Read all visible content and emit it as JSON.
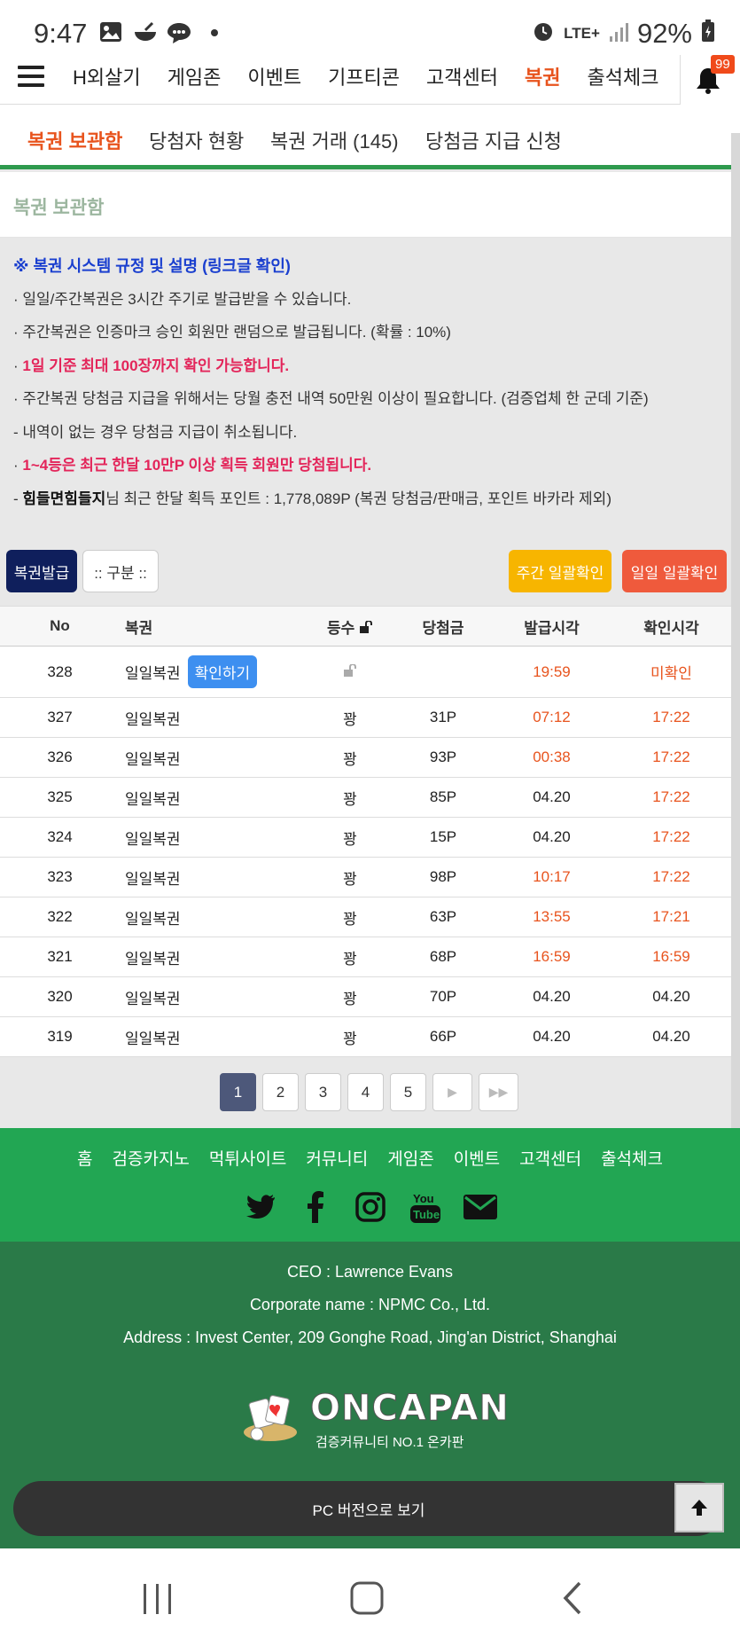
{
  "status_bar": {
    "time": "9:47",
    "network": "LTE+",
    "battery": "92%"
  },
  "top_nav": {
    "items": [
      "H외살기",
      "게임존",
      "이벤트",
      "기프티콘",
      "고객센터",
      "복권",
      "출석체크"
    ],
    "active_index": 5,
    "notification_count": "99"
  },
  "sub_tabs": [
    "복권 보관함",
    "당첨자 현황",
    "복권 거래 (145)",
    "당첨금 지급 신청"
  ],
  "section_title": "복권 보관함",
  "rules": {
    "heading": "※ 복권 시스템 규정 및 설명 (링크글 확인)",
    "line1": "· 일일/주간복권은 3시간 주기로 발급받을 수 있습니다.",
    "line2": "· 주간복권은 인증마크 승인 회원만 랜덤으로 발급됩니다. (확률 : 10%)",
    "line3": "1일 기준 최대 100장까지 확인 가능합니다.",
    "line4": "· 주간복권 당첨금 지급을 위해서는 당월 충전 내역 50만원 이상이 필요합니다. (검증업체 한 군데 기준)",
    "line5": " - 내역이 없는 경우 당첨금 지급이 취소됩니다.",
    "line6": "1~4등은 최근 한달 10만P 이상 획득 회원만 당첨됩니다.",
    "line7_user": "힘들면힘들지",
    "line7_rest": "님 최근 한달 획득 포인트 : 1,778,089P (복권 당첨금/판매금, 포인트 바카라 제외)"
  },
  "buttons": {
    "issue": "복권발급",
    "category": ":: 구분 ::",
    "weekly_check": "주간 일괄확인",
    "daily_check": "일일 일괄확인"
  },
  "table": {
    "headers": [
      "No",
      "복권",
      "등수",
      "당첨금",
      "발급시각",
      "확인시각"
    ],
    "first_row": {
      "no": "328",
      "name": "일일복권",
      "confirm_label": "확인하기",
      "issued": "19:59",
      "checked": "미확인"
    },
    "rows": [
      {
        "no": "327",
        "name": "일일복권",
        "rank": "꽝",
        "prize": "31P",
        "issued": "07:12",
        "checked": "17:22"
      },
      {
        "no": "326",
        "name": "일일복권",
        "rank": "꽝",
        "prize": "93P",
        "issued": "00:38",
        "checked": "17:22"
      },
      {
        "no": "325",
        "name": "일일복권",
        "rank": "꽝",
        "prize": "85P",
        "issued": "04.20",
        "checked": "17:22"
      },
      {
        "no": "324",
        "name": "일일복권",
        "rank": "꽝",
        "prize": "15P",
        "issued": "04.20",
        "checked": "17:22"
      },
      {
        "no": "323",
        "name": "일일복권",
        "rank": "꽝",
        "prize": "98P",
        "issued": "10:17",
        "checked": "17:22"
      },
      {
        "no": "322",
        "name": "일일복권",
        "rank": "꽝",
        "prize": "63P",
        "issued": "13:55",
        "checked": "17:21"
      },
      {
        "no": "321",
        "name": "일일복권",
        "rank": "꽝",
        "prize": "68P",
        "issued": "16:59",
        "checked": "16:59"
      },
      {
        "no": "320",
        "name": "일일복권",
        "rank": "꽝",
        "prize": "70P",
        "issued": "04.20",
        "checked": "04.20"
      },
      {
        "no": "319",
        "name": "일일복권",
        "rank": "꽝",
        "prize": "66P",
        "issued": "04.20",
        "checked": "04.20"
      }
    ]
  },
  "pagination": {
    "pages": [
      "1",
      "2",
      "3",
      "4",
      "5"
    ],
    "current": "1"
  },
  "footer": {
    "nav": [
      "홈",
      "검증카지노",
      "먹튀사이트",
      "커뮤니티",
      "게임존",
      "이벤트",
      "고객센터",
      "출석체크"
    ],
    "ceo": "CEO : Lawrence Evans",
    "corp": "Corporate name : NPMC Co., Ltd.",
    "address": "Address : Invest Center, 209 Gonghe Road, Jing'an District, Shanghai",
    "logo_text": "ONCAPAN",
    "logo_sub": "검증커뮤니티 NO.1 온카판",
    "pc_version": "PC 버전으로 보기"
  },
  "colors": {
    "accent": "#e8541e",
    "footer_green": "#22a653",
    "footer_dark": "#2a7a48",
    "navy": "#0f1f5c"
  }
}
